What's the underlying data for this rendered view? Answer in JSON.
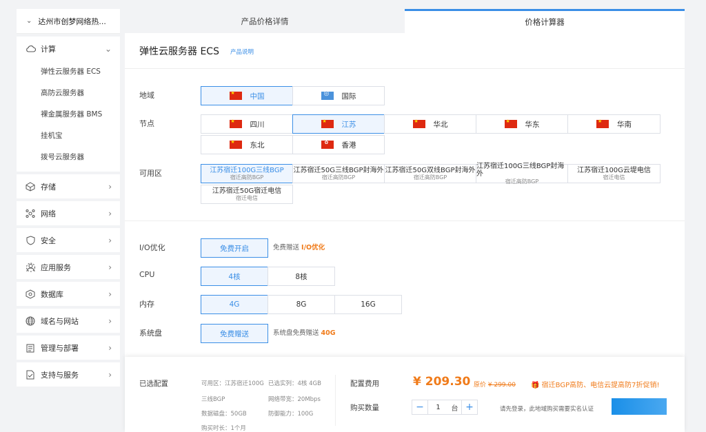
{
  "sidebar": {
    "header": "达州市创梦网络热...",
    "groups": [
      {
        "label": "计算",
        "icon": "cloud-icon"
      },
      {
        "label": "存储",
        "icon": "storage-icon"
      },
      {
        "label": "网络",
        "icon": "network-icon"
      },
      {
        "label": "安全",
        "icon": "shield-icon"
      },
      {
        "label": "应用服务",
        "icon": "app-service-icon"
      },
      {
        "label": "数据库",
        "icon": "database-icon"
      },
      {
        "label": "域名与网站",
        "icon": "globe-icon"
      },
      {
        "label": "管理与部署",
        "icon": "clipboard-icon"
      },
      {
        "label": "支持与服务",
        "icon": "support-icon"
      }
    ],
    "compute_items": [
      "弹性云服务器 ECS",
      "高防云服务器",
      "裸金属服务器 BMS",
      "挂机宝",
      "拨号云服务器"
    ]
  },
  "tabs": [
    "产品价格详情",
    "价格计算器"
  ],
  "product": {
    "title": "弹性云服务器 ECS",
    "link": "产品说明"
  },
  "labels": {
    "region": "地域",
    "node": "节点",
    "zone": "可用区",
    "io": "I/O优化",
    "cpu": "CPU",
    "memory": "内存",
    "disk": "系统盘"
  },
  "region": [
    "中国",
    "国际"
  ],
  "nodes": [
    "四川",
    "江苏",
    "华北",
    "华东",
    "华南",
    "东北",
    "香港"
  ],
  "zones": [
    {
      "name": "江苏宿迁100G三线BGP",
      "sub": "宿迁高防BGP"
    },
    {
      "name": "江苏宿迁50G三线BGP封海外",
      "sub": "宿迁高防BGP"
    },
    {
      "name": "江苏宿迁50G双线BGP封海外",
      "sub": "宿迁高防BGP"
    },
    {
      "name": "江苏宿迁100G三线BGP封海外",
      "sub": "宿迁高防BGP"
    },
    {
      "name": "江苏宿迁100G云堤电信",
      "sub": "宿迁电信"
    },
    {
      "name": "江苏宿迁50G宿迁电信",
      "sub": "宿迁电信"
    }
  ],
  "io": {
    "option": "免费开启",
    "note_prefix": "免费赠送 ",
    "note_bold": "I/O优化"
  },
  "cpu": [
    "4核",
    "8核"
  ],
  "memory": [
    "4G",
    "8G",
    "16G"
  ],
  "disk": {
    "option": "免费赠送",
    "note_prefix": "系统盘免费赠送 ",
    "note_bold": "40G"
  },
  "bottom": {
    "selected_label": "已选配置",
    "specs": [
      "可用区：江苏宿迁100G",
      "已选实列：4核 4GB",
      "三线BGP",
      "网络带宽：20Mbps",
      "数据磁盘：50GB",
      "防御能力：100G",
      "购买时长：1个月"
    ],
    "fee_label": "配置费用",
    "price": "¥ 209.30",
    "orig_prefix": "原价",
    "orig_price": "¥ 299.00",
    "promo": "宿迁BGP高防、电信云提高防7折促销!",
    "qty_label": "购买数量",
    "qty": "1",
    "qty_unit": "台",
    "login_note": "请先登录，此地域购买需要实名认证"
  }
}
